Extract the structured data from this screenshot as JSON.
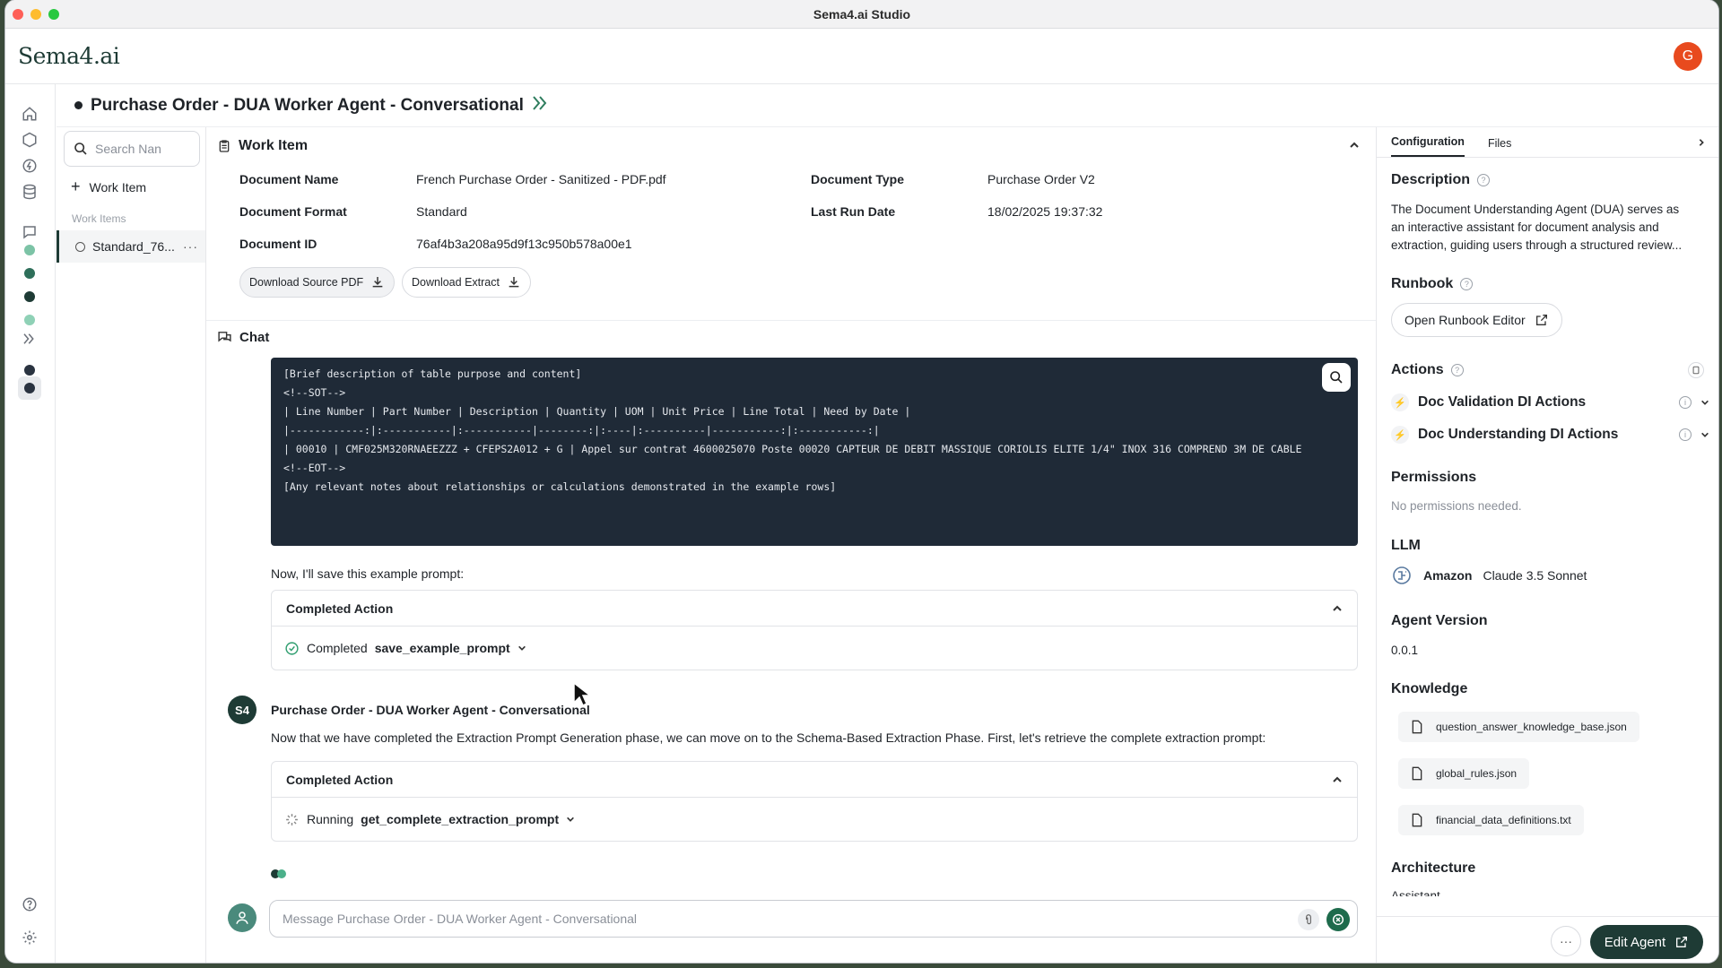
{
  "window": {
    "title": "Sema4.ai Studio"
  },
  "app": {
    "logo": "Sema4.ai",
    "avatar_letter": "G"
  },
  "agent": {
    "title": "Purchase Order - DUA Worker Agent - Conversational"
  },
  "left_panel": {
    "search_placeholder": "Search Nan",
    "new_work_item": "Work Item",
    "section_label": "Work Items",
    "items": [
      {
        "label": "Standard_76...",
        "more": "···"
      }
    ]
  },
  "work_item": {
    "header": "Work Item",
    "fields": {
      "document_name_label": "Document Name",
      "document_name": "French Purchase Order - Sanitized - PDF.pdf",
      "document_type_label": "Document Type",
      "document_type": "Purchase Order V2",
      "document_format_label": "Document Format",
      "document_format": "Standard",
      "last_run_label": "Last Run Date",
      "last_run": "18/02/2025 19:37:32",
      "document_id_label": "Document ID",
      "document_id": "76af4b3a208a95d9f13c950b578a00e1"
    },
    "download_source": "Download Source PDF",
    "download_extract": "Download Extract"
  },
  "chat": {
    "header": "Chat",
    "code_lines": [
      "[Brief description of table purpose and content]",
      "",
      "<!--SOT-->",
      "| Line Number | Part Number | Description | Quantity | UOM | Unit Price | Line Total | Need by Date |",
      "|------------:|:-----------|:-----------|--------:|:----|:----------|-----------:|:-----------:|",
      "| 00010 | CMF025M320RNAEEZZZ + CFEPS2A012 + G | Appel sur contrat 4600025070 Poste 00020 CAPTEUR DE DEBIT MASSIQUE CORIOLIS ELITE 1/4\" INOX 316 COMPREND 3M DE CABLE",
      "<!--EOT-->",
      "",
      "[Any relevant notes about relationships or calculations demonstrated in the example rows]"
    ],
    "save_text": "Now, I'll save this example prompt:",
    "action1": {
      "header": "Completed Action",
      "status": "Completed",
      "name": "save_example_prompt"
    },
    "agent_avatar": "S4",
    "agent_name": "Purchase Order - DUA Worker Agent - Conversational",
    "agent_message": "Now that we have completed the Extraction Prompt Generation phase, we can move on to the Schema-Based Extraction Phase. First, let's retrieve the complete extraction prompt:",
    "action2": {
      "header": "Completed Action",
      "status": "Running",
      "name": "get_complete_extraction_prompt"
    },
    "composer_placeholder": "Message Purchase Order - DUA Worker Agent - Conversational"
  },
  "right_panel": {
    "tabs": [
      "Configuration",
      "Files"
    ],
    "description_title": "Description",
    "description_lines": [
      "The Document Understanding Agent (DUA) serves as",
      "an interactive assistant for document analysis and",
      "extraction, guiding users through a structured review..."
    ],
    "runbook_title": "Runbook",
    "runbook_button": "Open Runbook Editor",
    "actions_title": "Actions",
    "actions": [
      "Doc Validation DI Actions",
      "Doc Understanding DI Actions"
    ],
    "permissions_title": "Permissions",
    "permissions_text": "No permissions needed.",
    "llm_title": "LLM",
    "llm_provider": "Amazon",
    "llm_model": "Claude 3.5 Sonnet",
    "version_title": "Agent Version",
    "version": "0.0.1",
    "knowledge_title": "Knowledge",
    "knowledge_files": [
      "question_answer_knowledge_base.json",
      "global_rules.json",
      "financial_data_definitions.txt"
    ],
    "architecture_title": "Architecture",
    "architecture_value": "Assistant",
    "more_label": "···",
    "edit_button": "Edit Agent"
  },
  "colors": {
    "brand": "#1e3b35",
    "accent_green": "#2e9d6e",
    "code_bg": "#1f2a37"
  }
}
